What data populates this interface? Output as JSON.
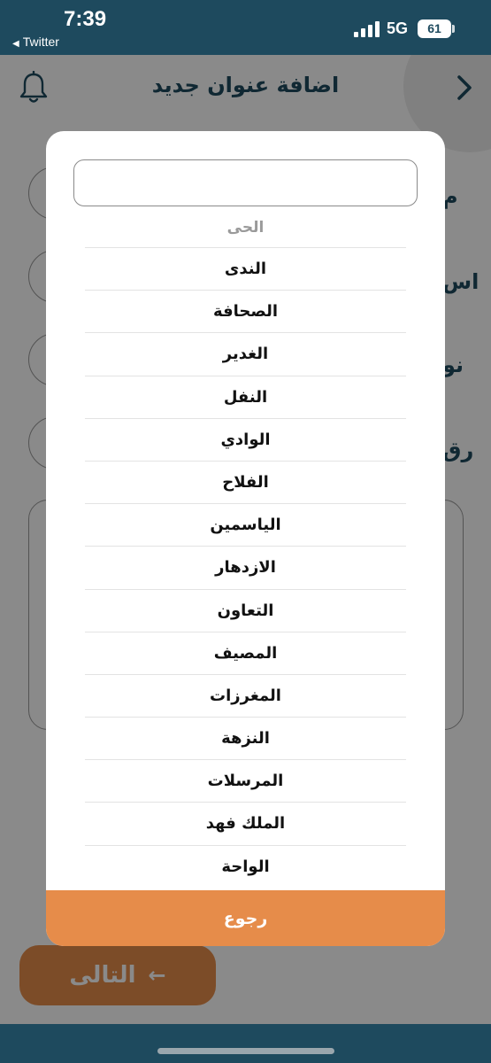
{
  "status_bar": {
    "time": "7:39",
    "back_app": "Twitter",
    "network": "5G",
    "battery": "61"
  },
  "header": {
    "title": "اضافة عنوان جديد"
  },
  "form_labels": [
    "م",
    "اس",
    "نو",
    "رق"
  ],
  "modal": {
    "search_value": "",
    "list_header": "الحى",
    "districts": [
      "الندى",
      "الصحافة",
      "الغدير",
      "النفل",
      "الوادي",
      "الفلاح",
      "الياسمين",
      "الازدهار",
      "التعاون",
      "المصيف",
      "المغرزات",
      "النزهة",
      "المرسلات",
      "الملك فهد",
      "الواحة"
    ],
    "back_label": "رجوع"
  },
  "footer": {
    "next_label": "التالى"
  },
  "colors": {
    "brand_dark": "#1e4a5e",
    "accent_orange": "#e68c4a"
  }
}
